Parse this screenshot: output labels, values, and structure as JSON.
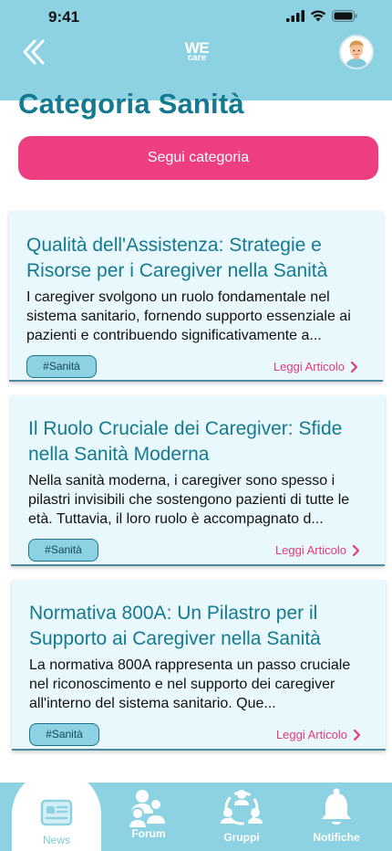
{
  "status_bar": {
    "time": "9:41"
  },
  "header": {
    "logo_top": "WE",
    "logo_bottom": "care"
  },
  "page": {
    "title": "Categoria Sanità",
    "follow_label": "Segui categoria"
  },
  "articles": [
    {
      "title": "Qualità dell'Assistenza: Strategie e Risorse per i Caregiver nella Sanità",
      "excerpt": "I caregiver svolgono un ruolo fondamentale nel sistema sanitario, fornendo supporto essenziale ai pazienti e contribuendo significativamente a...",
      "tag": "#Sanità",
      "link": "Leggi Articolo"
    },
    {
      "title": "Il Ruolo Cruciale dei Caregiver: Sfide nella Sanità Moderna",
      "excerpt": "Nella sanità moderna, i caregiver sono spesso i pilastri invisibili che sostengono pazienti di tutte le età. Tuttavia, il loro ruolo è accompagnato d...",
      "tag": "#Sanità",
      "link": "Leggi Articolo"
    },
    {
      "title": "Normativa 800A: Un Pilastro per il Supporto ai Caregiver nella Sanità",
      "excerpt": "La normativa 800A rappresenta un passo cruciale nel riconoscimento e nel supporto dei caregiver all'interno del sistema sanitario. Que...",
      "tag": "#Sanità",
      "link": "Leggi Articolo"
    }
  ],
  "nav": {
    "items": [
      {
        "label": "News",
        "icon": "news-icon",
        "active": true
      },
      {
        "label": "Forum",
        "icon": "forum-icon",
        "active": false
      },
      {
        "label": "Gruppi",
        "icon": "groups-icon",
        "active": false
      },
      {
        "label": "Notifiche",
        "icon": "bell-icon",
        "active": false
      }
    ]
  },
  "colors": {
    "header_bg": "#8dd2e2",
    "title": "#137a91",
    "follow_button": "#ee3e82",
    "card_bg": "#e9f8fc",
    "link": "#e33a7c"
  }
}
